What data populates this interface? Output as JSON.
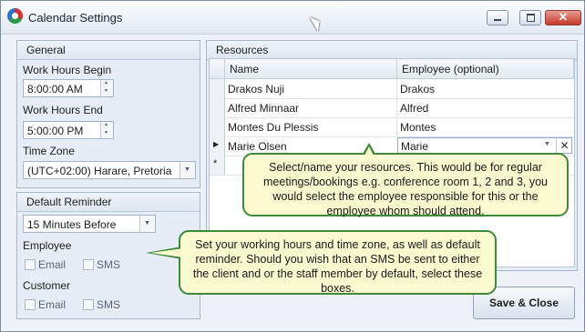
{
  "window": {
    "title": "Calendar Settings"
  },
  "general": {
    "header": "General",
    "work_begin_label": "Work Hours Begin",
    "work_begin_value": "8:00:00 AM",
    "work_end_label": "Work Hours End",
    "work_end_value": "5:00:00 PM",
    "timezone_label": "Time Zone",
    "timezone_value": "(UTC+02:00) Harare, Pretoria"
  },
  "reminder": {
    "header": "Default Reminder",
    "value": "15 Minutes Before",
    "employee_label": "Employee",
    "customer_label": "Customer",
    "email_label": "Email",
    "sms_label": "SMS"
  },
  "resources": {
    "header": "Resources",
    "columns": [
      "Name",
      "Employee (optional)"
    ],
    "rows": [
      {
        "name": "Drakos Nuji",
        "employee": "Drakos"
      },
      {
        "name": "Alfred Minnaar",
        "employee": "Alfred"
      },
      {
        "name": "Montes Du Plessis",
        "employee": "Montes"
      },
      {
        "name": "Marie Olsen",
        "employee": "Marie"
      }
    ],
    "new_row_marker": "*"
  },
  "callouts": {
    "resources": "Select/name your resources. This would be for regular meetings/bookings e.g. conference room 1, 2 and 3, you would select the employee responsible for this or the employee whom should attend.",
    "general": "Set your working hours and time zone, as well as default reminder.  Should you wish that an SMS be sent to either the client and or the staff member by default, select these boxes."
  },
  "buttons": {
    "save_close": "Save & Close"
  },
  "colors": {
    "callout_border": "#3e8a3a",
    "callout_fill": "#fbf9d0",
    "close_button": "#c53a2b"
  }
}
